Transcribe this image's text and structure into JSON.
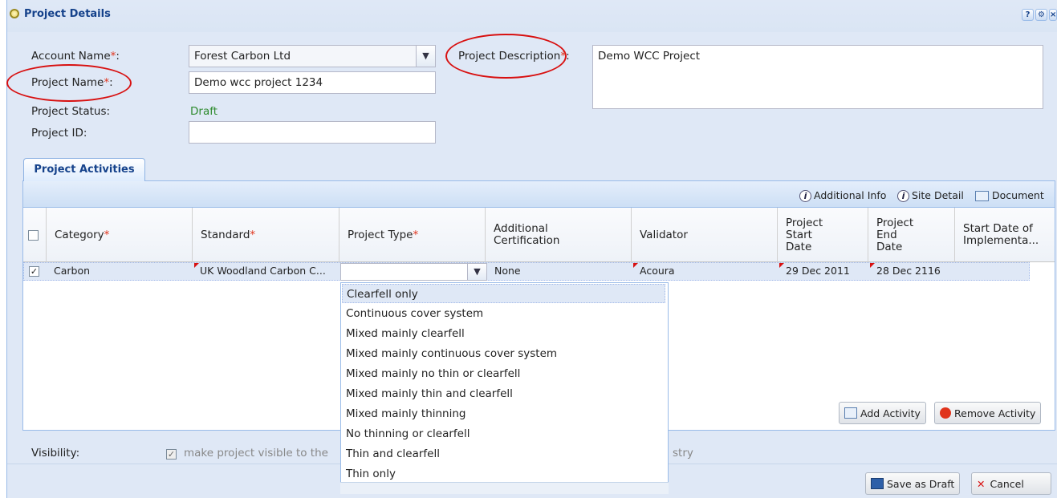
{
  "window": {
    "title": "Project Details",
    "tools": [
      "?",
      "⚙",
      "×"
    ]
  },
  "form": {
    "account_label": "Account Name",
    "account_value": "Forest Carbon Ltd",
    "project_name_label": "Project Name",
    "project_name_value": "Demo wcc project 1234",
    "status_label": "Project Status:",
    "status_value": "Draft",
    "status_color": "#2e8b2e",
    "project_id_label": "Project ID:",
    "project_id_value": "",
    "description_label": "Project Description",
    "description_value": "Demo WCC Project",
    "required_mark": "*",
    "colon": ":"
  },
  "tab": {
    "label": "Project Activities"
  },
  "toolbar": {
    "additional_info": "Additional Info",
    "site_detail": "Site Detail",
    "document": "Document"
  },
  "grid": {
    "columns": [
      "Category",
      "Standard",
      "Project Type",
      "Additional Certification",
      "Validator",
      "Project Start Date",
      "Project End Date",
      "Start Date of Implementa..."
    ],
    "row": {
      "checked": true,
      "category": "Carbon",
      "standard": "UK Woodland Carbon C...",
      "project_type": "",
      "additional_certification": "None",
      "validator": "Acoura",
      "start_date": "29 Dec 2011",
      "end_date": "28 Dec 2116",
      "implementation_date": ""
    }
  },
  "project_type_options": [
    "Clearfell only",
    "Continuous cover system",
    "Mixed mainly clearfell",
    "Mixed mainly continuous cover system",
    "Mixed mainly no thin or clearfell",
    "Mixed mainly thin and clearfell",
    "Mixed mainly thinning",
    "No thinning or clearfell",
    "Thin and clearfell",
    "Thin only"
  ],
  "buttons": {
    "add_activity": "Add Activity",
    "remove_activity": "Remove Activity",
    "save_draft": "Save as Draft",
    "cancel": "Cancel"
  },
  "visibility": {
    "label": "Visibility:",
    "checkbox_text_left": "make project visible to the",
    "checkbox_text_right": "stry",
    "checked": true
  }
}
